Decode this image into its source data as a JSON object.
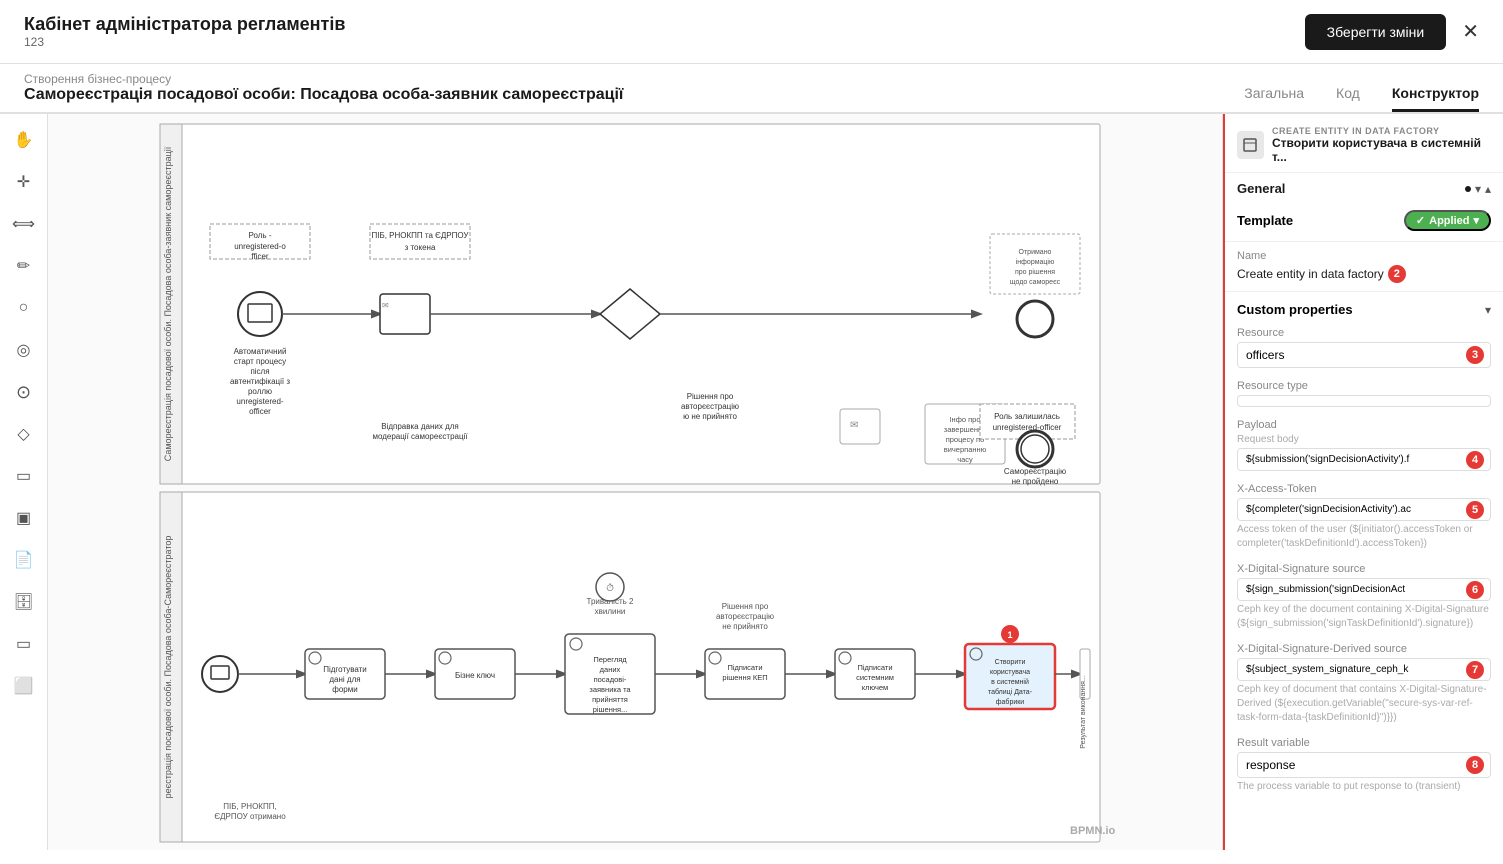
{
  "header": {
    "title": "Кабінет адміністратора регламентів",
    "subtitle": "123",
    "save_button": "Зберегти зміни"
  },
  "breadcrumb": {
    "top": "Створення бізнес-процесу",
    "bottom": "Самореєстрація посадової особи: Посадова особа-заявник самореєстрації"
  },
  "tabs": [
    {
      "label": "Загальна",
      "active": false
    },
    {
      "label": "Код",
      "active": false
    },
    {
      "label": "Конструктор",
      "active": true
    }
  ],
  "toolbar": {
    "tools": [
      "✋",
      "✛",
      "⟺",
      "✏",
      "○",
      "◎",
      "○",
      "◇",
      "▭",
      "▣",
      "📄",
      "🗄",
      "▭",
      "⬜"
    ]
  },
  "right_panel": {
    "header_label": "CREATE ENTITY IN DATA FACTORY",
    "header_name": "Створити користувача в системній т...",
    "general_label": "General",
    "template_label": "Template",
    "template_badge": "Applied",
    "name_label": "Name",
    "name_value": "Create entity in data factory",
    "name_badge": "2",
    "custom_props_label": "Custom properties",
    "resource_label": "Resource",
    "resource_value": "officers",
    "resource_badge": "3",
    "resource_type_label": "Resource type",
    "payload_label": "Payload",
    "payload_value": "${submission('signDecisionActivity').f",
    "payload_badge": "4",
    "request_body_label": "Request body",
    "x_access_token_label": "X-Access-Token",
    "x_access_token_value": "${completer('signDecisionActivity').ac",
    "x_access_token_badge": "5",
    "x_access_token_desc": "Access token of the user (${initiator().accessToken or completer('taskDefinitionId').accessToken})",
    "x_digital_sig_src_label": "X-Digital-Signature source",
    "x_digital_sig_src_value": "${sign_submission('signDecisionAct",
    "x_digital_sig_src_badge": "6",
    "x_digital_sig_src_desc": "Ceph key of the document containing X-Digital-Signature (${sign_submission('signTaskDefinitionId').signature})",
    "x_digital_sig_derived_label": "X-Digital-Signature-Derived source",
    "x_digital_sig_derived_value": "${subject_system_signature_ceph_k",
    "x_digital_sig_derived_badge": "7",
    "x_digital_sig_derived_desc": "Ceph key of document that contains X-Digital-Signature-Derived (${execution.getVariable(\"secure-sys-var-ref-task-form-data-{taskDefinitionId}\")}})",
    "result_var_label": "Result variable",
    "result_var_value": "response",
    "result_var_badge": "8",
    "result_var_desc": "The process variable to put response to (transient)"
  },
  "canvas": {
    "pool1_label": "Самореєстрація посадової особи. Посадова особа-заявник самореєстрації",
    "pool2_label": "реєстрація посадової особи. Посадова особа-Самореєстратор",
    "elements": {
      "start_event": "Автоматичний старт процесу після автентифікації з роллю unregistered-officer",
      "role_note": "Роль - unregistered-officer",
      "pib_note": "ПІБ, РНОКПП та ЄДРПОУ з токена",
      "send_data": "Відправка даних для модерації самореєстрації",
      "decision": "Рішення про авторєєстрацію не прийнято",
      "received_info": "Отримано інформацію про рішення щодо самореєс...",
      "info_end": "Інфо про завершення процесу по вичерпанню часу",
      "role_left": "Роль залишилась unregistered-officer",
      "not_passed": "Самореєстрацію не пройдено",
      "pool2_prepare": "Підготувати дані для форми",
      "pool2_key": "Бізне ключ",
      "pool2_review": "Перегляд даних посадові-заявника та прийняття рішення про самореєстраці ю",
      "pool2_sign_kep": "Підписати рішення КЕП",
      "pool2_sign_sys": "Підписати системним ключем",
      "pool2_create": "Створити користувача в системній таблиці Дата-фабрики",
      "pool2_result": "Результат виконання Самореєстрац ій пройден...",
      "pool2_duration": "Тривалість 2 хвилини",
      "pool2_decision": "Рішення про авторєєстрацію не прийнято",
      "pool2_pib": "ПІБ, РНОКПП, ЄДРПОУ отримано"
    }
  },
  "icons": {
    "hand": "✋",
    "crosshair": "✛",
    "arrows": "⟺",
    "pen": "✏",
    "circle_outline": "○",
    "circle_filled": "◎",
    "circle": "○",
    "diamond": "◇",
    "rect": "▭",
    "rect_fill": "▣",
    "doc": "📄",
    "db": "🗄",
    "rect2": "▭",
    "rect3": "⬜",
    "gear": "⚙",
    "chevron_down": "▾",
    "chevron_up": "▴",
    "check": "✓"
  }
}
